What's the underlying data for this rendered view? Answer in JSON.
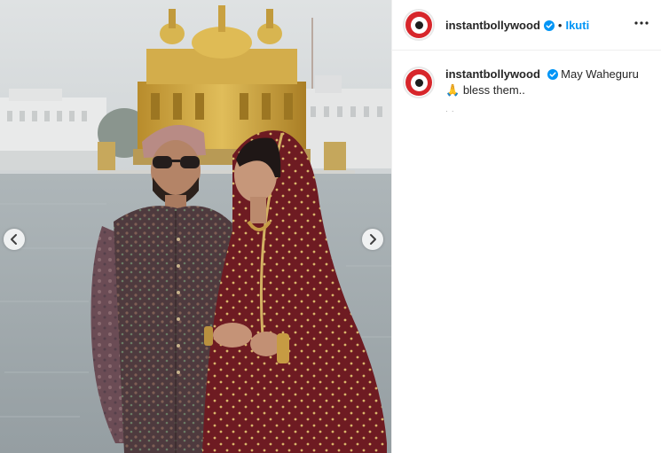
{
  "post": {
    "image_alt": "",
    "account": "instantbollywood",
    "verified": true,
    "separator": "•",
    "follow_label": "Ikuti",
    "more_icon": "more-horizontal-icon",
    "caption": {
      "username": "instantbollywood",
      "text_line1": "May Waheguru",
      "emoji": "🙏",
      "text_line2": "bless them..",
      "meta": "· ·"
    },
    "nav": {
      "prev_icon": "chevron-left-icon",
      "next_icon": "chevron-right-icon"
    }
  },
  "colors": {
    "accent": "#0095f6",
    "avatar_red": "#d7262b",
    "divider": "#efefef",
    "text": "#262626"
  }
}
